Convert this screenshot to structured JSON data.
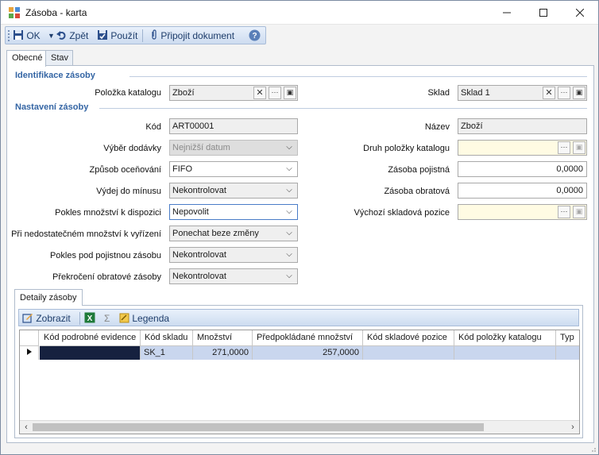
{
  "window": {
    "title": "Zásoba - karta"
  },
  "toolbar": {
    "ok_label": "OK",
    "back_label": "Zpět",
    "use_label": "Použít",
    "attach_label": "Připojit dokument"
  },
  "tabs": [
    {
      "label": "Obecné"
    },
    {
      "label": "Stav"
    }
  ],
  "sections": {
    "identification": "Identifikace zásoby",
    "settings": "Nastavení zásoby"
  },
  "fields": {
    "catalog_item": {
      "label": "Položka katalogu",
      "value": "Zboží"
    },
    "warehouse": {
      "label": "Sklad",
      "value": "Sklad 1"
    },
    "code": {
      "label": "Kód",
      "value": "ART00001"
    },
    "name": {
      "label": "Název",
      "value": "Zboží"
    },
    "supplier_choice": {
      "label": "Výběr dodávky",
      "value": "Nejnižší datum"
    },
    "catalog_item_type": {
      "label": "Druh položky katalogu",
      "value": ""
    },
    "valuation_method": {
      "label": "Způsob oceňování",
      "value": "FIFO"
    },
    "safety_stock": {
      "label": "Zásoba pojistná",
      "value": "0,0000"
    },
    "negative_issue": {
      "label": "Výdej do mínusu",
      "value": "Nekontrolovat"
    },
    "turnover_stock": {
      "label": "Zásoba obratová",
      "value": "0,0000"
    },
    "available_decrease": {
      "label": "Pokles množství k dispozici",
      "value": "Nepovolit"
    },
    "default_location": {
      "label": "Výchozí skladová pozice",
      "value": ""
    },
    "insufficient_qty": {
      "label": "Při nedostatečném množství k vyřízení",
      "value": "Ponechat beze změny"
    },
    "below_safety": {
      "label": "Pokles pod pojistnou zásobu",
      "value": "Nekontrolovat"
    },
    "over_turnover": {
      "label": "Překročení obratové zásoby",
      "value": "Nekontrolovat"
    }
  },
  "details": {
    "tab_label": "Detaily zásoby",
    "toolbar": {
      "show_label": "Zobrazit",
      "sum_symbol": "Σ",
      "legend_label": "Legenda"
    },
    "columns": [
      "Kód podrobné evidence",
      "Kód skladu",
      "Množství",
      "Předpokládané množství",
      "Kód skladové pozice",
      "Kód položky katalogu",
      "Typ"
    ],
    "rows": [
      [
        "",
        "SK_1",
        "271,0000",
        "257,0000",
        "",
        "",
        ""
      ]
    ]
  },
  "colors": {
    "section_title": "#3465a4",
    "toolbar_text": "#1e3d6b",
    "selected_row": "#c9d6ee",
    "selected_cell": "#16213f",
    "yellow_field": "#fffbe3"
  },
  "icons": {
    "app": "grid-app-icon",
    "save": "save-icon",
    "undo": "undo-icon",
    "use": "apply-icon",
    "attach": "paperclip-icon",
    "help": "help-icon",
    "edit": "edit-icon",
    "excel": "excel-icon",
    "legend": "legend-icon"
  }
}
